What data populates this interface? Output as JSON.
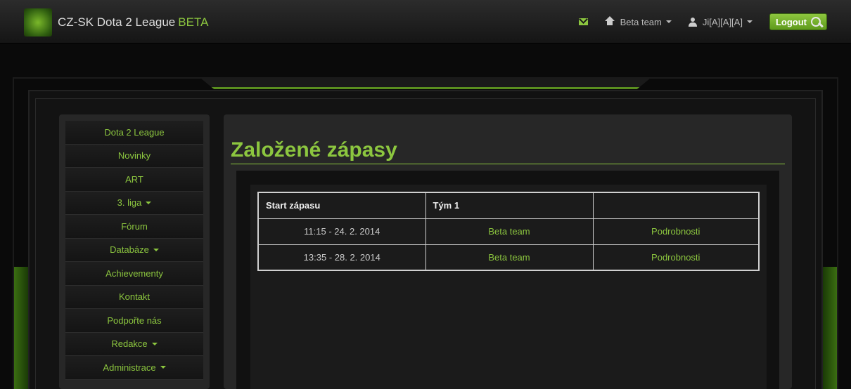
{
  "header": {
    "brand": "CZ-SK Dota 2 League",
    "brand_beta": "BETA",
    "team_menu": "Beta team",
    "user_menu": "Ji[A][A][A]",
    "logout": "Logout"
  },
  "sidebar": {
    "items": [
      {
        "label": "Dota 2 League",
        "dropdown": false
      },
      {
        "label": "Novinky",
        "dropdown": false
      },
      {
        "label": "ART",
        "dropdown": false
      },
      {
        "label": "3. liga",
        "dropdown": true
      },
      {
        "label": "Fórum",
        "dropdown": false
      },
      {
        "label": "Databáze",
        "dropdown": true
      },
      {
        "label": "Achievementy",
        "dropdown": false
      },
      {
        "label": "Kontakt",
        "dropdown": false
      },
      {
        "label": "Podpořte nás",
        "dropdown": false
      },
      {
        "label": "Redakce",
        "dropdown": true
      },
      {
        "label": "Administrace",
        "dropdown": true
      }
    ]
  },
  "main": {
    "title": "Založené zápasy",
    "table": {
      "headers": [
        "Start zápasu",
        "Tým 1",
        ""
      ],
      "rows": [
        {
          "start": "11:15 - 24. 2. 2014",
          "team": "Beta team",
          "details": "Podrobnosti"
        },
        {
          "start": "13:35 - 28. 2. 2014",
          "team": "Beta team",
          "details": "Podrobnosti"
        }
      ]
    }
  },
  "colors": {
    "accent": "#8cc63f",
    "background": "#0a0a0a",
    "panel": "#272727"
  },
  "icons": [
    "logo-icon",
    "mail-icon",
    "home-icon",
    "user-icon",
    "key-icon",
    "caret-down-icon"
  ]
}
